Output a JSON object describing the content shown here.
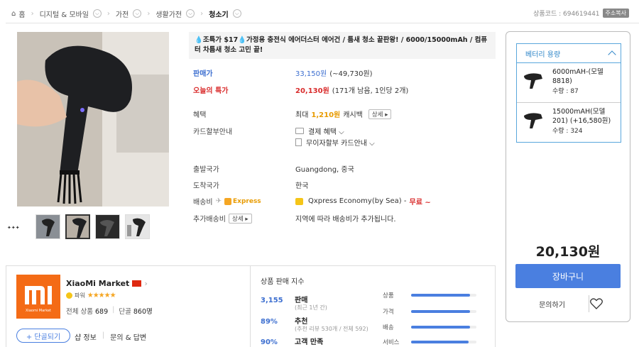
{
  "breadcrumb": {
    "home": "홈",
    "items": [
      "디지털 & 모바일",
      "가전",
      "생활가전",
      "청소기"
    ]
  },
  "product_code": {
    "label": "상품코드 : 694619441",
    "copy": "주소복사"
  },
  "title": "💧조특가 $17💧가정용 충전식 에어더스터 에어건 / 틈새 청소 끝판왕! / 6000/15000mAh / 컴퓨터 차틈새 청소 고민 끝!",
  "info": {
    "sale_label": "판매가",
    "sale_price": "33,150원",
    "sale_price_alt": "(~49,730원)",
    "today_label": "오늘의 특가",
    "today_price": "20,130원",
    "today_note": "(171개 남음, 1인당 2개)",
    "benefit_label": "혜택",
    "benefit_prefix": "최대",
    "benefit_amount": "1,210원",
    "benefit_suffix": "캐시백",
    "benefit_btn": "상세 ▸",
    "card_label": "카드할부안내",
    "card_line1": "결제 혜택 ⌵",
    "card_line2": "무이자할부 카드안내 ⌵",
    "origin_label": "출발국가",
    "origin_value": "Guangdong, 중국",
    "dest_label": "도착국가",
    "dest_value": "한국",
    "ship_label": "배송비",
    "ship_badge": "Express",
    "ship_method": "Qxpress Economy(by Sea) -",
    "ship_free": "무료 ~",
    "extra_label": "추가배송비",
    "extra_btn": "상세 ▸",
    "extra_value": "지역에 따라 배송비가 추가됩니다."
  },
  "options": {
    "header": "베터리 용량",
    "items": [
      {
        "name": "6000mAH-(모델8818)",
        "qty": "수량 : 87"
      },
      {
        "name": "15000mAH(모델201) (+16,580원)",
        "qty": "수량 : 324"
      }
    ]
  },
  "buy": {
    "price": "20,130원",
    "cart": "장바구니",
    "inquiry": "문의하기"
  },
  "seller": {
    "name": "XiaoMi Market",
    "logo_text": "Xiaomi Market",
    "grade": "파워",
    "total_label": "전체 상품",
    "total_value": "689",
    "regular_label": "단골",
    "regular_value": "860명",
    "follow": "+ 단골되기",
    "links": [
      "샵 정보",
      "문의 & 답변"
    ]
  },
  "index": {
    "title": "상품 판매 지수",
    "rows": [
      {
        "num": "3,155",
        "label": "판매",
        "sub": "(최근 1년 간)"
      },
      {
        "num": "89%",
        "label": "추천",
        "sub": "(추천 리뷰 530개 / 전체 592)"
      },
      {
        "num": "90%",
        "label": "고객 만족",
        "sub": ""
      }
    ],
    "bars": [
      {
        "label": "상품",
        "value": 0.9
      },
      {
        "label": "가격",
        "value": 0.9
      },
      {
        "label": "배송",
        "value": 0.9
      },
      {
        "label": "서비스",
        "value": 0.88
      }
    ]
  },
  "colors": {
    "accent": "#4a7fe0",
    "price_red": "#d92c2c",
    "cashback": "#e89b00",
    "xiaomi": "#f46b16"
  }
}
